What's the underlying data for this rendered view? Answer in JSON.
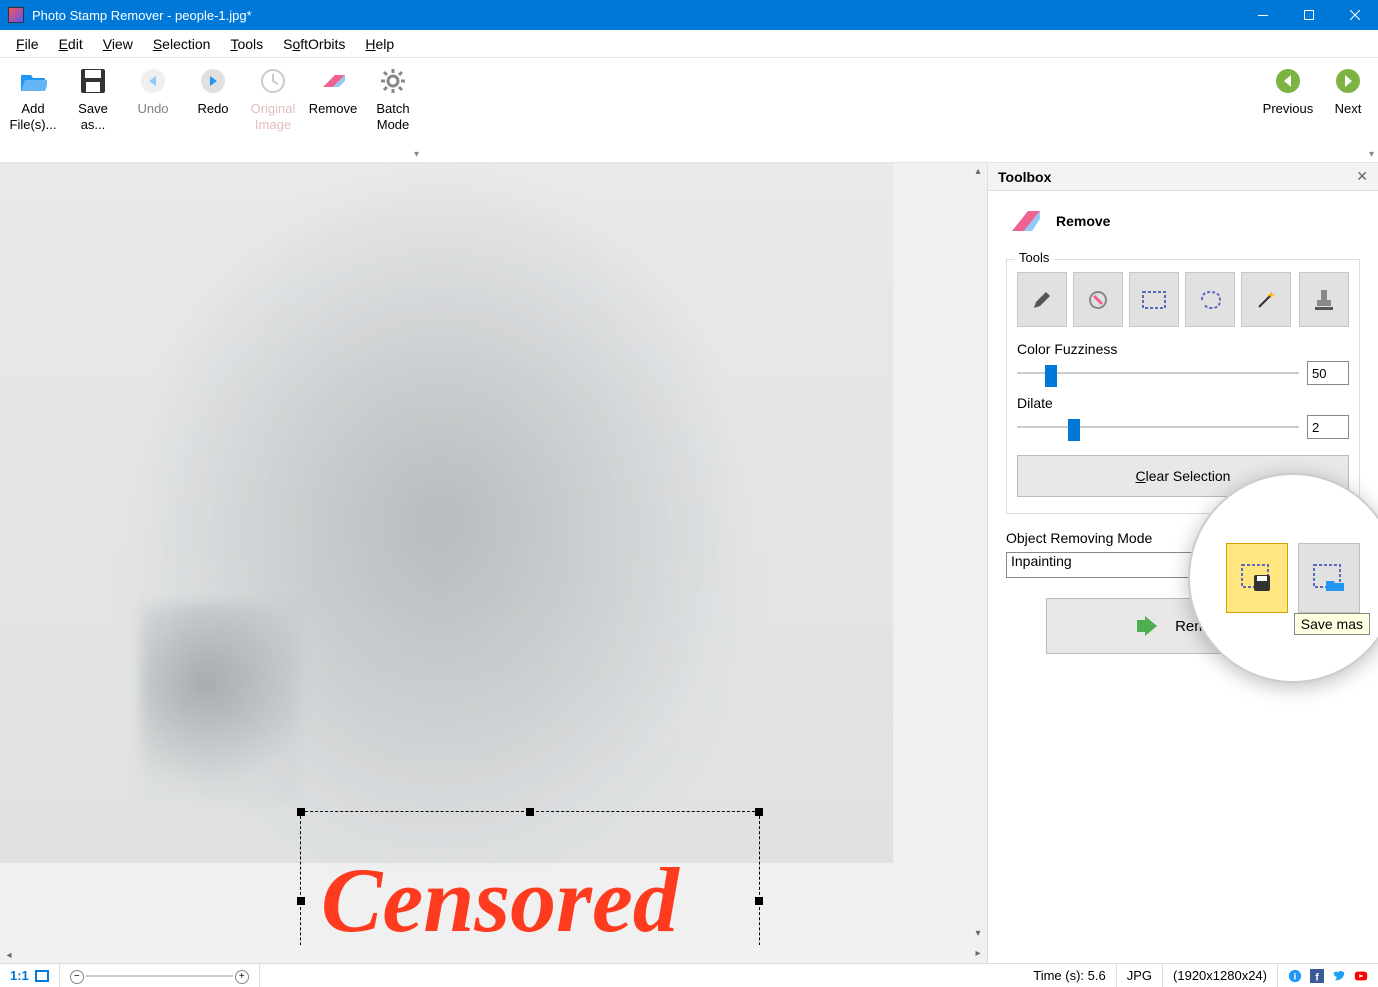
{
  "window": {
    "title": "Photo Stamp Remover - people-1.jpg*"
  },
  "menu": {
    "items": [
      "File",
      "Edit",
      "View",
      "Selection",
      "Tools",
      "SoftOrbits",
      "Help"
    ]
  },
  "toolbar": {
    "add": "Add\nFile(s)...",
    "saveas": "Save\nas...",
    "undo": "Undo",
    "redo": "Redo",
    "original": "Original\nImage",
    "remove": "Remove",
    "batch": "Batch\nMode",
    "previous": "Previous",
    "next": "Next"
  },
  "canvas": {
    "watermark": "Censored"
  },
  "toolbox": {
    "title": "Toolbox",
    "section": "Remove",
    "tools_label": "Tools",
    "fuzz_label": "Color Fuzziness",
    "fuzz_value": "50",
    "dilate_label": "Dilate",
    "dilate_value": "2",
    "clear": "Clear Selection",
    "mode_label": "Object Removing Mode",
    "mode_value": "Inpainting",
    "remove_btn": "Remove",
    "tooltip": "Save mas"
  },
  "status": {
    "ratio": "1:1",
    "time": "Time (s): 5.6",
    "format": "JPG",
    "dims": "(1920x1280x24)"
  }
}
